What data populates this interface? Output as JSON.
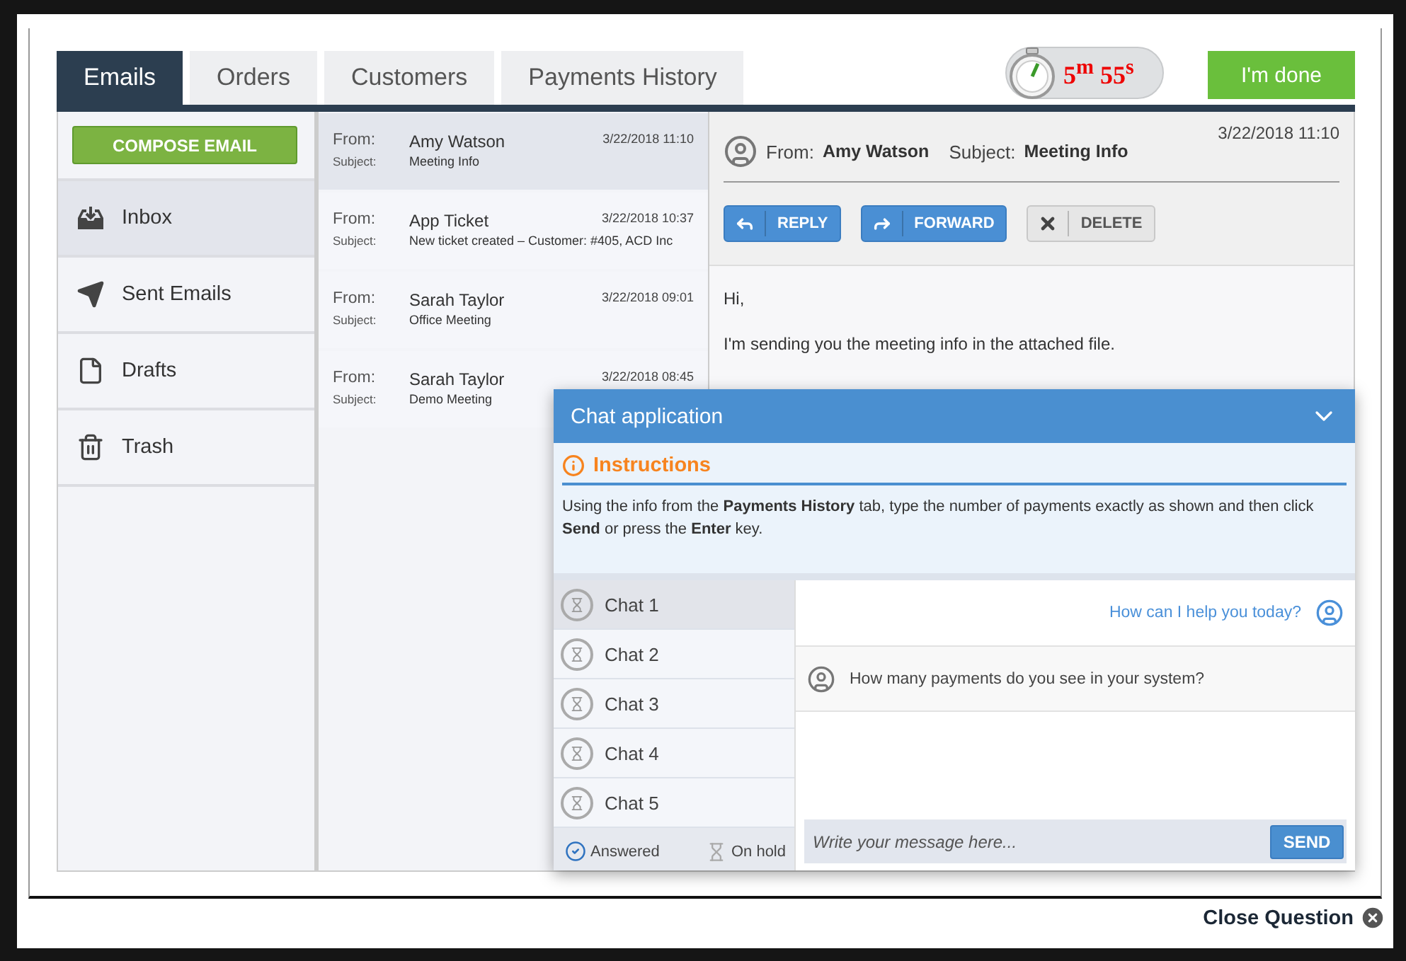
{
  "tabs": [
    {
      "label": "Emails",
      "selected": true
    },
    {
      "label": "Orders",
      "selected": false
    },
    {
      "label": "Customers",
      "selected": false
    },
    {
      "label": "Payments History",
      "selected": false
    }
  ],
  "timer": {
    "text": "5$^{m}$ 55$^{s}$"
  },
  "done_button": "I'm done",
  "compose_button": "COMPOSE EMAIL",
  "folders": [
    {
      "label": "Inbox",
      "kind": "inbox",
      "selected": true
    },
    {
      "label": "Sent Emails",
      "kind": "sent",
      "selected": false
    },
    {
      "label": "Drafts",
      "kind": "drafts",
      "selected": false
    },
    {
      "label": "Trash",
      "kind": "trash",
      "selected": false
    }
  ],
  "emails": [
    {
      "from_label": "From:",
      "from": "Amy Watson",
      "subject_label": "Subject:",
      "subject": "Meeting Info",
      "date": "3/22/2018 11:10",
      "selected": true
    },
    {
      "from_label": "From:",
      "from": "App Ticket",
      "subject_label": "Subject:",
      "subject": "New ticket created – Customer: #405, ACD Inc",
      "date": "3/22/2018 10:37",
      "selected": false
    },
    {
      "from_label": "From:",
      "from": "Sarah Taylor",
      "subject_label": "Subject:",
      "subject": "Office Meeting",
      "date": "3/22/2018 09:01",
      "selected": false
    },
    {
      "from_label": "From:",
      "from": "Sarah Taylor",
      "subject_label": "Subject:",
      "subject": "Demo Meeting",
      "date": "3/22/2018 08:45",
      "selected": false
    }
  ],
  "reader": {
    "from_label": "From:",
    "from": "Amy Watson",
    "subject_label": "Subject:",
    "subject": "Meeting Info",
    "date": "3/22/2018 11:10",
    "actions": [
      {
        "label": "REPLY",
        "kind": "reply"
      },
      {
        "label": "FORWARD",
        "kind": "forward"
      },
      {
        "label": "DELETE",
        "kind": "delete"
      }
    ],
    "body": [
      "Hi,",
      "I'm sending you the meeting info in the attached file."
    ]
  },
  "chat": {
    "title": "Chat application",
    "instructions_title": "Instructions",
    "instructions": "Using the info from the **Payments History** tab, type the number of payments exactly as shown and then click **Send** or press the **Enter** key.",
    "chats": [
      {
        "label": "Chat 1",
        "selected": true
      },
      {
        "label": "Chat 2",
        "selected": false
      },
      {
        "label": "Chat 3",
        "selected": false
      },
      {
        "label": "Chat 4",
        "selected": false
      },
      {
        "label": "Chat 5",
        "selected": false
      }
    ],
    "legend": [
      {
        "label": "Answered",
        "kind": "answered"
      },
      {
        "label": "On hold",
        "kind": "hold"
      }
    ],
    "messages": [
      {
        "kind": "agent",
        "text": "How can I help you today?"
      },
      {
        "kind": "customer",
        "text": "How many payments do you see in your system?"
      }
    ],
    "input": {
      "placeholder": "Write your message here..."
    },
    "send_button": "SEND"
  },
  "close_question": "Close Question"
}
